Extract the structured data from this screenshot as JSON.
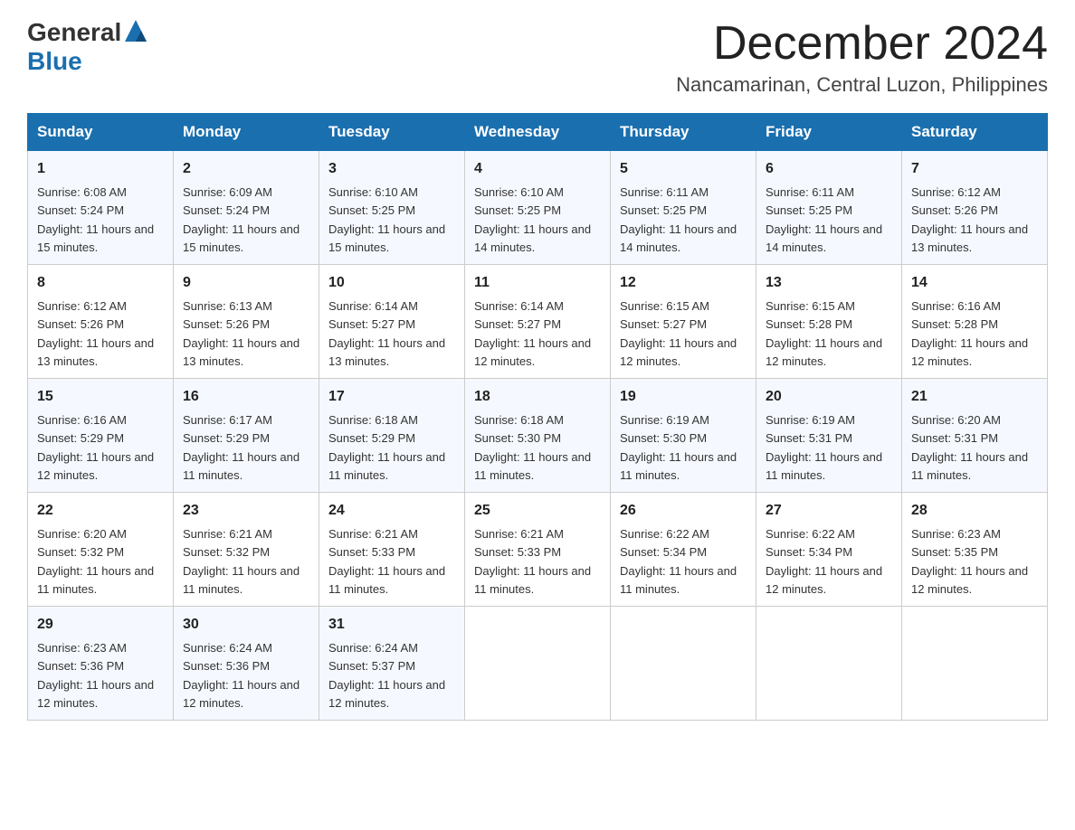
{
  "logo": {
    "general": "General",
    "blue": "Blue"
  },
  "header": {
    "title": "December 2024",
    "subtitle": "Nancamarinan, Central Luzon, Philippines"
  },
  "days_of_week": [
    "Sunday",
    "Monday",
    "Tuesday",
    "Wednesday",
    "Thursday",
    "Friday",
    "Saturday"
  ],
  "weeks": [
    [
      {
        "num": "1",
        "sunrise": "6:08 AM",
        "sunset": "5:24 PM",
        "daylight": "11 hours and 15 minutes."
      },
      {
        "num": "2",
        "sunrise": "6:09 AM",
        "sunset": "5:24 PM",
        "daylight": "11 hours and 15 minutes."
      },
      {
        "num": "3",
        "sunrise": "6:10 AM",
        "sunset": "5:25 PM",
        "daylight": "11 hours and 15 minutes."
      },
      {
        "num": "4",
        "sunrise": "6:10 AM",
        "sunset": "5:25 PM",
        "daylight": "11 hours and 14 minutes."
      },
      {
        "num": "5",
        "sunrise": "6:11 AM",
        "sunset": "5:25 PM",
        "daylight": "11 hours and 14 minutes."
      },
      {
        "num": "6",
        "sunrise": "6:11 AM",
        "sunset": "5:25 PM",
        "daylight": "11 hours and 14 minutes."
      },
      {
        "num": "7",
        "sunrise": "6:12 AM",
        "sunset": "5:26 PM",
        "daylight": "11 hours and 13 minutes."
      }
    ],
    [
      {
        "num": "8",
        "sunrise": "6:12 AM",
        "sunset": "5:26 PM",
        "daylight": "11 hours and 13 minutes."
      },
      {
        "num": "9",
        "sunrise": "6:13 AM",
        "sunset": "5:26 PM",
        "daylight": "11 hours and 13 minutes."
      },
      {
        "num": "10",
        "sunrise": "6:14 AM",
        "sunset": "5:27 PM",
        "daylight": "11 hours and 13 minutes."
      },
      {
        "num": "11",
        "sunrise": "6:14 AM",
        "sunset": "5:27 PM",
        "daylight": "11 hours and 12 minutes."
      },
      {
        "num": "12",
        "sunrise": "6:15 AM",
        "sunset": "5:27 PM",
        "daylight": "11 hours and 12 minutes."
      },
      {
        "num": "13",
        "sunrise": "6:15 AM",
        "sunset": "5:28 PM",
        "daylight": "11 hours and 12 minutes."
      },
      {
        "num": "14",
        "sunrise": "6:16 AM",
        "sunset": "5:28 PM",
        "daylight": "11 hours and 12 minutes."
      }
    ],
    [
      {
        "num": "15",
        "sunrise": "6:16 AM",
        "sunset": "5:29 PM",
        "daylight": "11 hours and 12 minutes."
      },
      {
        "num": "16",
        "sunrise": "6:17 AM",
        "sunset": "5:29 PM",
        "daylight": "11 hours and 11 minutes."
      },
      {
        "num": "17",
        "sunrise": "6:18 AM",
        "sunset": "5:29 PM",
        "daylight": "11 hours and 11 minutes."
      },
      {
        "num": "18",
        "sunrise": "6:18 AM",
        "sunset": "5:30 PM",
        "daylight": "11 hours and 11 minutes."
      },
      {
        "num": "19",
        "sunrise": "6:19 AM",
        "sunset": "5:30 PM",
        "daylight": "11 hours and 11 minutes."
      },
      {
        "num": "20",
        "sunrise": "6:19 AM",
        "sunset": "5:31 PM",
        "daylight": "11 hours and 11 minutes."
      },
      {
        "num": "21",
        "sunrise": "6:20 AM",
        "sunset": "5:31 PM",
        "daylight": "11 hours and 11 minutes."
      }
    ],
    [
      {
        "num": "22",
        "sunrise": "6:20 AM",
        "sunset": "5:32 PM",
        "daylight": "11 hours and 11 minutes."
      },
      {
        "num": "23",
        "sunrise": "6:21 AM",
        "sunset": "5:32 PM",
        "daylight": "11 hours and 11 minutes."
      },
      {
        "num": "24",
        "sunrise": "6:21 AM",
        "sunset": "5:33 PM",
        "daylight": "11 hours and 11 minutes."
      },
      {
        "num": "25",
        "sunrise": "6:21 AM",
        "sunset": "5:33 PM",
        "daylight": "11 hours and 11 minutes."
      },
      {
        "num": "26",
        "sunrise": "6:22 AM",
        "sunset": "5:34 PM",
        "daylight": "11 hours and 11 minutes."
      },
      {
        "num": "27",
        "sunrise": "6:22 AM",
        "sunset": "5:34 PM",
        "daylight": "11 hours and 12 minutes."
      },
      {
        "num": "28",
        "sunrise": "6:23 AM",
        "sunset": "5:35 PM",
        "daylight": "11 hours and 12 minutes."
      }
    ],
    [
      {
        "num": "29",
        "sunrise": "6:23 AM",
        "sunset": "5:36 PM",
        "daylight": "11 hours and 12 minutes."
      },
      {
        "num": "30",
        "sunrise": "6:24 AM",
        "sunset": "5:36 PM",
        "daylight": "11 hours and 12 minutes."
      },
      {
        "num": "31",
        "sunrise": "6:24 AM",
        "sunset": "5:37 PM",
        "daylight": "11 hours and 12 minutes."
      },
      null,
      null,
      null,
      null
    ]
  ],
  "colors": {
    "header_bg": "#1a6faf",
    "accent_blue": "#1a6faf"
  }
}
